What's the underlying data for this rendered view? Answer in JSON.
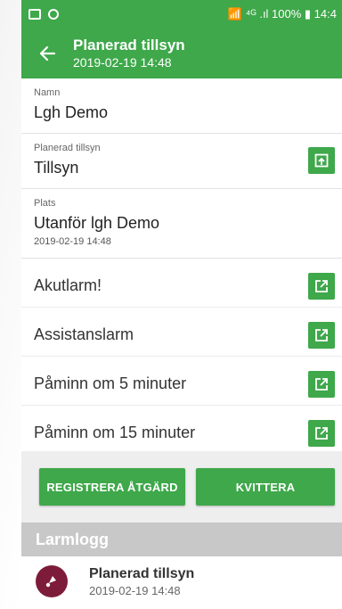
{
  "statusbar": {
    "right_text": "📶 ⁴ᴳ .ıl 100% ▮ 14:4"
  },
  "appbar": {
    "title": "Planerad tillsyn",
    "subtitle": "2019-02-19 14:48"
  },
  "fields": [
    {
      "label": "Namn",
      "value": "Lgh Demo"
    },
    {
      "label": "Planerad tillsyn",
      "value": "Tillsyn"
    },
    {
      "label": "Plats",
      "value": "Utanför lgh Demo",
      "sub": "2019-02-19 14:48"
    }
  ],
  "alarms": [
    {
      "label": "Akutlarm!"
    },
    {
      "label": "Assistanslarm"
    },
    {
      "label": "Påminn om 5 minuter"
    },
    {
      "label": "Påminn om 15 minuter"
    }
  ],
  "actions": {
    "register_label": "REGISTRERA ÅTGÄRD",
    "acknowledge_label": "KVITTERA"
  },
  "log": {
    "header": "Larmlogg",
    "items": [
      {
        "title": "Planerad tillsyn",
        "time": "2019-02-19 14:48"
      }
    ]
  },
  "colors": {
    "primary": "#3ea84a",
    "avatar": "#7d1c3a",
    "log_header": "#c8c8c8"
  }
}
